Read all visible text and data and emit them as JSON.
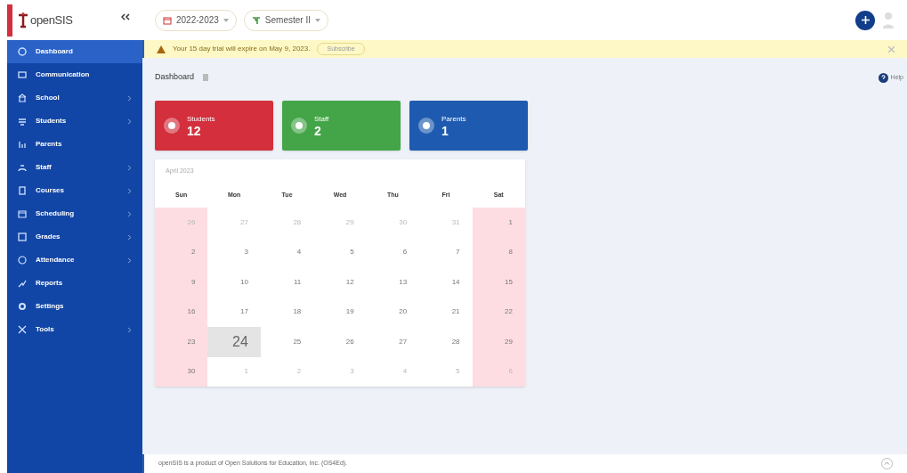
{
  "header": {
    "logo": "openSIS",
    "school_year": "2022-2023",
    "semester": "Semester II"
  },
  "sidebar": {
    "items": [
      {
        "label": "Dashboard",
        "selected": true,
        "has_submenu": false
      },
      {
        "label": "Communication",
        "selected": false,
        "has_submenu": false
      },
      {
        "label": "School",
        "selected": false,
        "has_submenu": true
      },
      {
        "label": "Students",
        "selected": false,
        "has_submenu": true
      },
      {
        "label": "Parents",
        "selected": false,
        "has_submenu": false
      },
      {
        "label": "Staff",
        "selected": false,
        "has_submenu": true
      },
      {
        "label": "Courses",
        "selected": false,
        "has_submenu": true
      },
      {
        "label": "Scheduling",
        "selected": false,
        "has_submenu": true
      },
      {
        "label": "Grades",
        "selected": false,
        "has_submenu": true
      },
      {
        "label": "Attendance",
        "selected": false,
        "has_submenu": true
      },
      {
        "label": "Reports",
        "selected": false,
        "has_submenu": false
      },
      {
        "label": "Settings",
        "selected": false,
        "has_submenu": false
      },
      {
        "label": "Tools",
        "selected": false,
        "has_submenu": true
      }
    ]
  },
  "trial_banner": {
    "message": "Your 15 day trial will expire on May 9, 2023.",
    "button": "Subscribe"
  },
  "page_title": "Dashboard",
  "help": "Help",
  "stat_cards": [
    {
      "label": "Students",
      "count": "12",
      "color": "#d32f3c"
    },
    {
      "label": "Staff",
      "count": "2",
      "color": "#43a547"
    },
    {
      "label": "Parents",
      "count": "1",
      "color": "#1e5bb0"
    }
  ],
  "calendar": {
    "month": "April 2023",
    "weekdays": [
      "Sun",
      "Mon",
      "Tue",
      "Wed",
      "Thu",
      "Fri",
      "Sat"
    ],
    "weeks": [
      [
        {
          "day": "26",
          "other_month": true,
          "today": false
        },
        {
          "day": "27",
          "other_month": true,
          "today": false
        },
        {
          "day": "28",
          "other_month": true,
          "today": false
        },
        {
          "day": "29",
          "other_month": true,
          "today": false
        },
        {
          "day": "30",
          "other_month": true,
          "today": false
        },
        {
          "day": "31",
          "other_month": true,
          "today": false
        },
        {
          "day": "1",
          "other_month": false,
          "today": false
        }
      ],
      [
        {
          "day": "2",
          "other_month": false,
          "today": false
        },
        {
          "day": "3",
          "other_month": false,
          "today": false
        },
        {
          "day": "4",
          "other_month": false,
          "today": false
        },
        {
          "day": "5",
          "other_month": false,
          "today": false
        },
        {
          "day": "6",
          "other_month": false,
          "today": false
        },
        {
          "day": "7",
          "other_month": false,
          "today": false
        },
        {
          "day": "8",
          "other_month": false,
          "today": false
        }
      ],
      [
        {
          "day": "9",
          "other_month": false,
          "today": false
        },
        {
          "day": "10",
          "other_month": false,
          "today": false
        },
        {
          "day": "11",
          "other_month": false,
          "today": false
        },
        {
          "day": "12",
          "other_month": false,
          "today": false
        },
        {
          "day": "13",
          "other_month": false,
          "today": false
        },
        {
          "day": "14",
          "other_month": false,
          "today": false
        },
        {
          "day": "15",
          "other_month": false,
          "today": false
        }
      ],
      [
        {
          "day": "16",
          "other_month": false,
          "today": false
        },
        {
          "day": "17",
          "other_month": false,
          "today": false
        },
        {
          "day": "18",
          "other_month": false,
          "today": false
        },
        {
          "day": "19",
          "other_month": false,
          "today": false
        },
        {
          "day": "20",
          "other_month": false,
          "today": false
        },
        {
          "day": "21",
          "other_month": false,
          "today": false
        },
        {
          "day": "22",
          "other_month": false,
          "today": false
        }
      ],
      [
        {
          "day": "23",
          "other_month": false,
          "today": false
        },
        {
          "day": "24",
          "other_month": false,
          "today": true
        },
        {
          "day": "25",
          "other_month": false,
          "today": false
        },
        {
          "day": "26",
          "other_month": false,
          "today": false
        },
        {
          "day": "27",
          "other_month": false,
          "today": false
        },
        {
          "day": "28",
          "other_month": false,
          "today": false
        },
        {
          "day": "29",
          "other_month": false,
          "today": false
        }
      ],
      [
        {
          "day": "30",
          "other_month": false,
          "today": false
        },
        {
          "day": "1",
          "other_month": true,
          "today": false
        },
        {
          "day": "2",
          "other_month": true,
          "today": false
        },
        {
          "day": "3",
          "other_month": true,
          "today": false
        },
        {
          "day": "4",
          "other_month": true,
          "today": false
        },
        {
          "day": "5",
          "other_month": true,
          "today": false
        },
        {
          "day": "6",
          "other_month": true,
          "today": false
        }
      ]
    ]
  },
  "footer": "openSIS is a product of Open Solutions for Education, Inc. (OS4Ed)."
}
